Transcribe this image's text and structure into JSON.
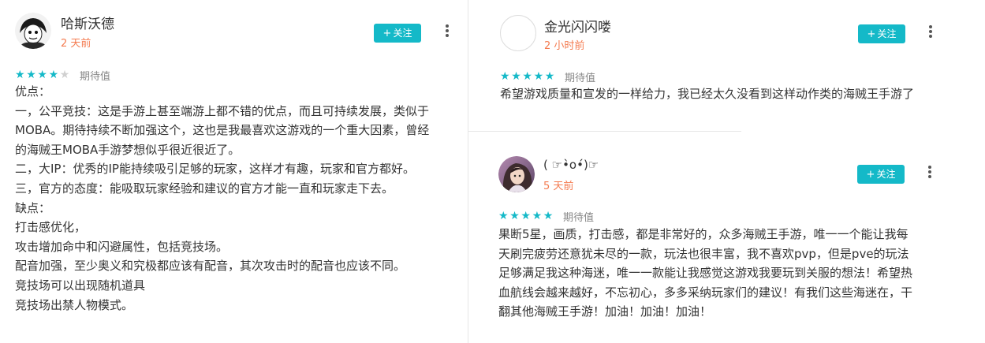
{
  "reviews": [
    {
      "username": "哈斯沃德",
      "time": "2 天前",
      "follow_label": "关注",
      "rating_stars": 4,
      "rating_max": 5,
      "rating_label": "期待值",
      "lines": [
        "优点：",
        "一，公平竞技：这是手游上甚至端游上都不错的优点，而且可持续发展，类似于",
        "MOBA。期待持续不断加强这个，这也是我最喜欢这游戏的一个重大因素，曾经",
        "的海贼王MOBA手游梦想似乎很近很近了。",
        "二，大IP：优秀的IP能持续吸引足够的玩家，这样才有趣，玩家和官方都好。",
        "三，官方的态度：能吸取玩家经验和建议的官方才能一直和玩家走下去。",
        "缺点：",
        "打击感优化，",
        "攻击增加命中和闪避属性，包括竞技场。",
        "配音加强，至少奥义和究极都应该有配音，其次攻击时的配音也应该不同。",
        "竞技场可以出现随机道具",
        "竞技场出禁人物模式。"
      ]
    },
    {
      "username": "金光闪闪喽",
      "time": "2 小时前",
      "follow_label": "关注",
      "rating_stars": 5,
      "rating_max": 5,
      "rating_label": "期待值",
      "lines": [
        "希望游戏质量和宣发的一样给力，我已经太久没看到这样动作类的海贼王手游了"
      ]
    },
    {
      "username": "( ☞•̀o•́)☞",
      "time": "5 天前",
      "follow_label": "关注",
      "rating_stars": 5,
      "rating_max": 5,
      "rating_label": "期待值",
      "lines": [
        "果断5星，画质，打击感，都是非常好的，众多海贼王手游，唯一一个能让我每",
        "天刷完疲劳还意犹未尽的一款，玩法也很丰富，我不喜欢pvp，但是pve的玩法",
        "足够满足我这种海迷，唯一一款能让我感觉这游戏我要玩到关服的想法！希望热",
        "血航线会越来越好，不忘初心，多多采纳玩家们的建议！有我们这些海迷在，干",
        "翻其他海贼王手游！加油！加油！加油！"
      ]
    }
  ],
  "colors": {
    "accent": "#14b9c8",
    "time": "#f47b50",
    "star_off": "#d0d0d0"
  },
  "icons": {
    "follow": "plus-icon",
    "more": "more-vertical-icon",
    "star": "star-icon"
  }
}
